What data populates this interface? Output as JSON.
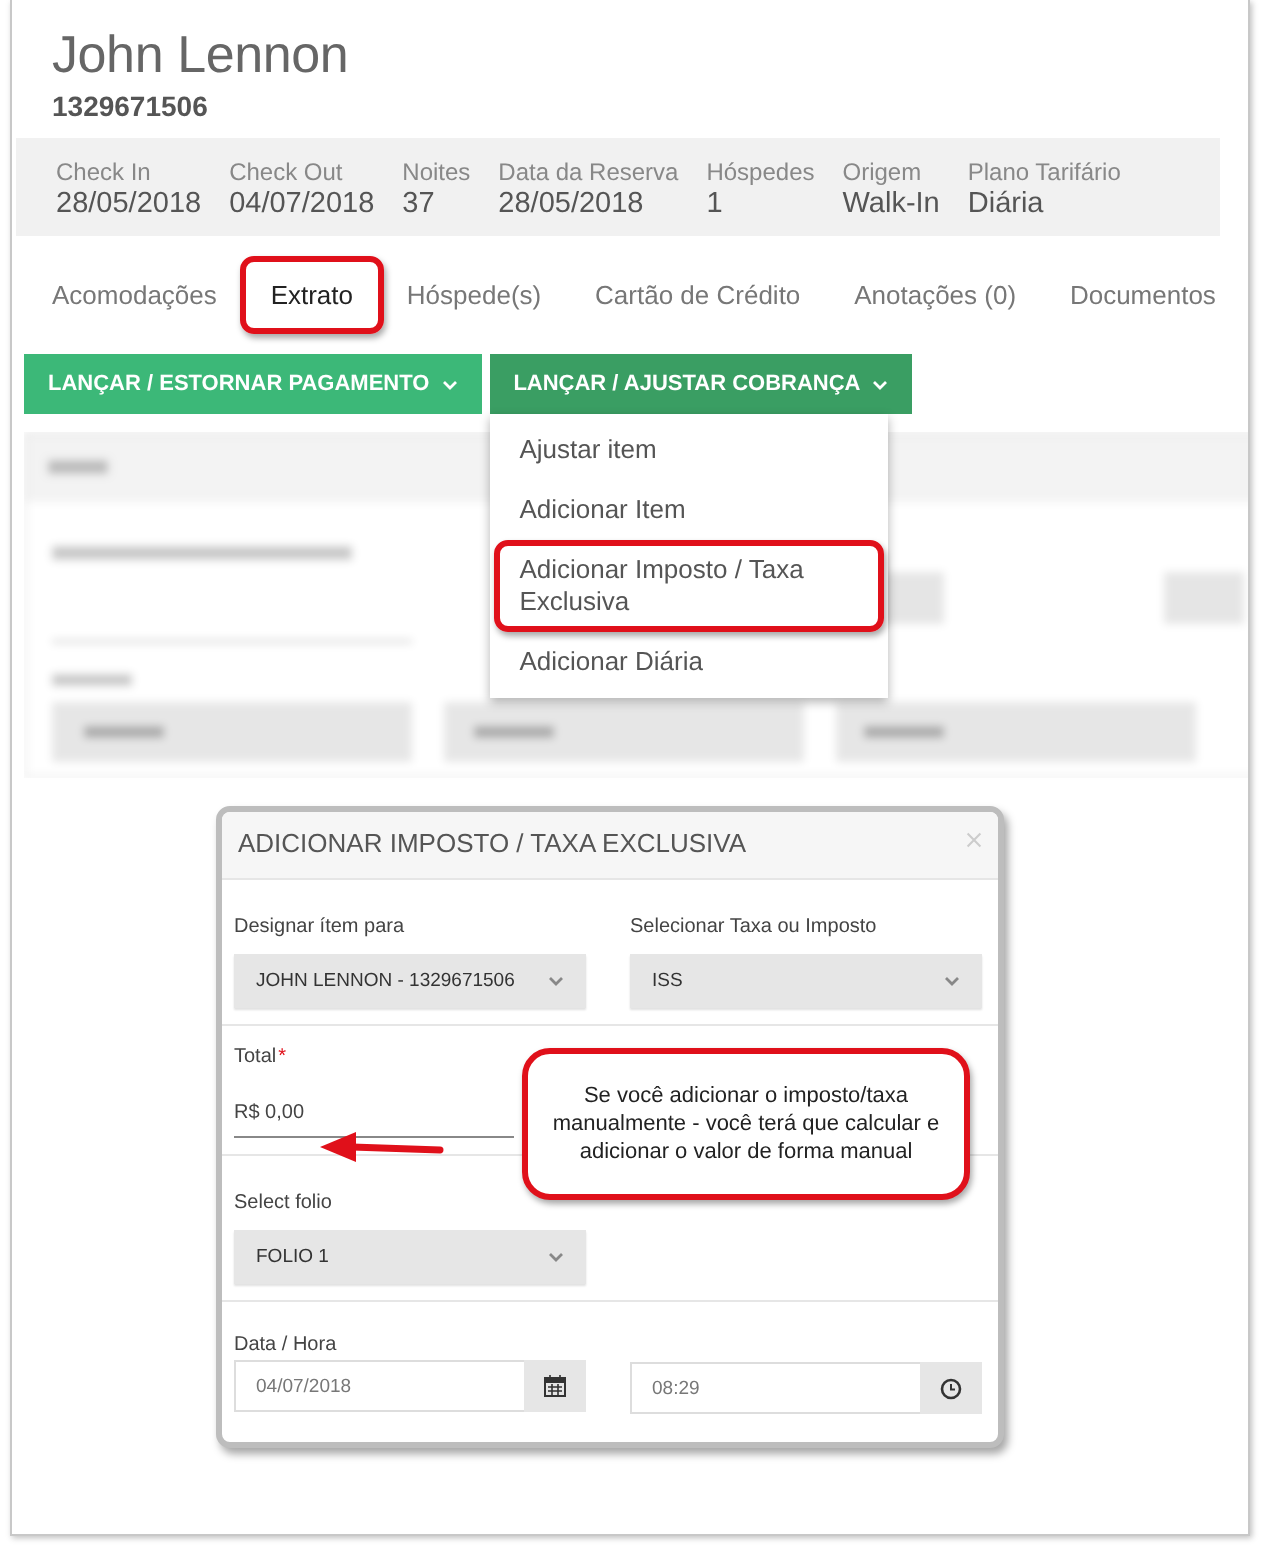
{
  "guest": {
    "name": "John Lennon",
    "number": "1329671506"
  },
  "summary": [
    {
      "label": "Check In",
      "value": "28/05/2018"
    },
    {
      "label": "Check Out",
      "value": "04/07/2018"
    },
    {
      "label": "Noites",
      "value": "37"
    },
    {
      "label": "Data da Reserva",
      "value": "28/05/2018"
    },
    {
      "label": "Hóspedes",
      "value": "1"
    },
    {
      "label": "Origem",
      "value": "Walk-In"
    },
    {
      "label": "Plano Tarifário",
      "value": "Diária"
    }
  ],
  "tabs": [
    {
      "label": "Acomodações",
      "selected": false,
      "highlighted": false
    },
    {
      "label": "Extrato",
      "selected": true,
      "highlighted": true
    },
    {
      "label": "Hóspede(s)",
      "selected": false,
      "highlighted": false
    },
    {
      "label": "Cartão de Crédito",
      "selected": false,
      "highlighted": false
    },
    {
      "label": "Anotações (0)",
      "selected": false,
      "highlighted": false
    },
    {
      "label": "Documentos",
      "selected": false,
      "highlighted": false
    }
  ],
  "action_buttons": [
    {
      "label": "LANÇAR / ESTORNAR PAGAMENTO",
      "expanded": false
    },
    {
      "label": "LANÇAR / AJUSTAR COBRANÇA",
      "expanded": true
    }
  ],
  "dropdown_menu": [
    {
      "label": "Ajustar item",
      "highlighted": false
    },
    {
      "label": "Adicionar Item",
      "highlighted": false
    },
    {
      "label": "Adicionar Imposto / Taxa Exclusiva",
      "highlighted": true
    },
    {
      "label": "Adicionar Diária",
      "highlighted": false
    }
  ],
  "modal": {
    "title": "ADICIONAR IMPOSTO / TAXA EXCLUSIVA",
    "assign_label": "Designar ítem para",
    "assign_value": "JOHN LENNON - 1329671506",
    "tax_label": "Selecionar Taxa ou Imposto",
    "tax_value": "ISS",
    "total_label": "Total",
    "total_required_mark": "*",
    "total_value": "R$ 0,00",
    "folio_label": "Select folio",
    "folio_value": "FOLIO 1",
    "datetime_label": "Data / Hora",
    "date_value": "04/07/2018",
    "time_value": "08:29"
  },
  "callout": {
    "text": "Se você adicionar o imposto/taxa manualmente - você terá que calcular e adicionar o valor de forma manual"
  }
}
